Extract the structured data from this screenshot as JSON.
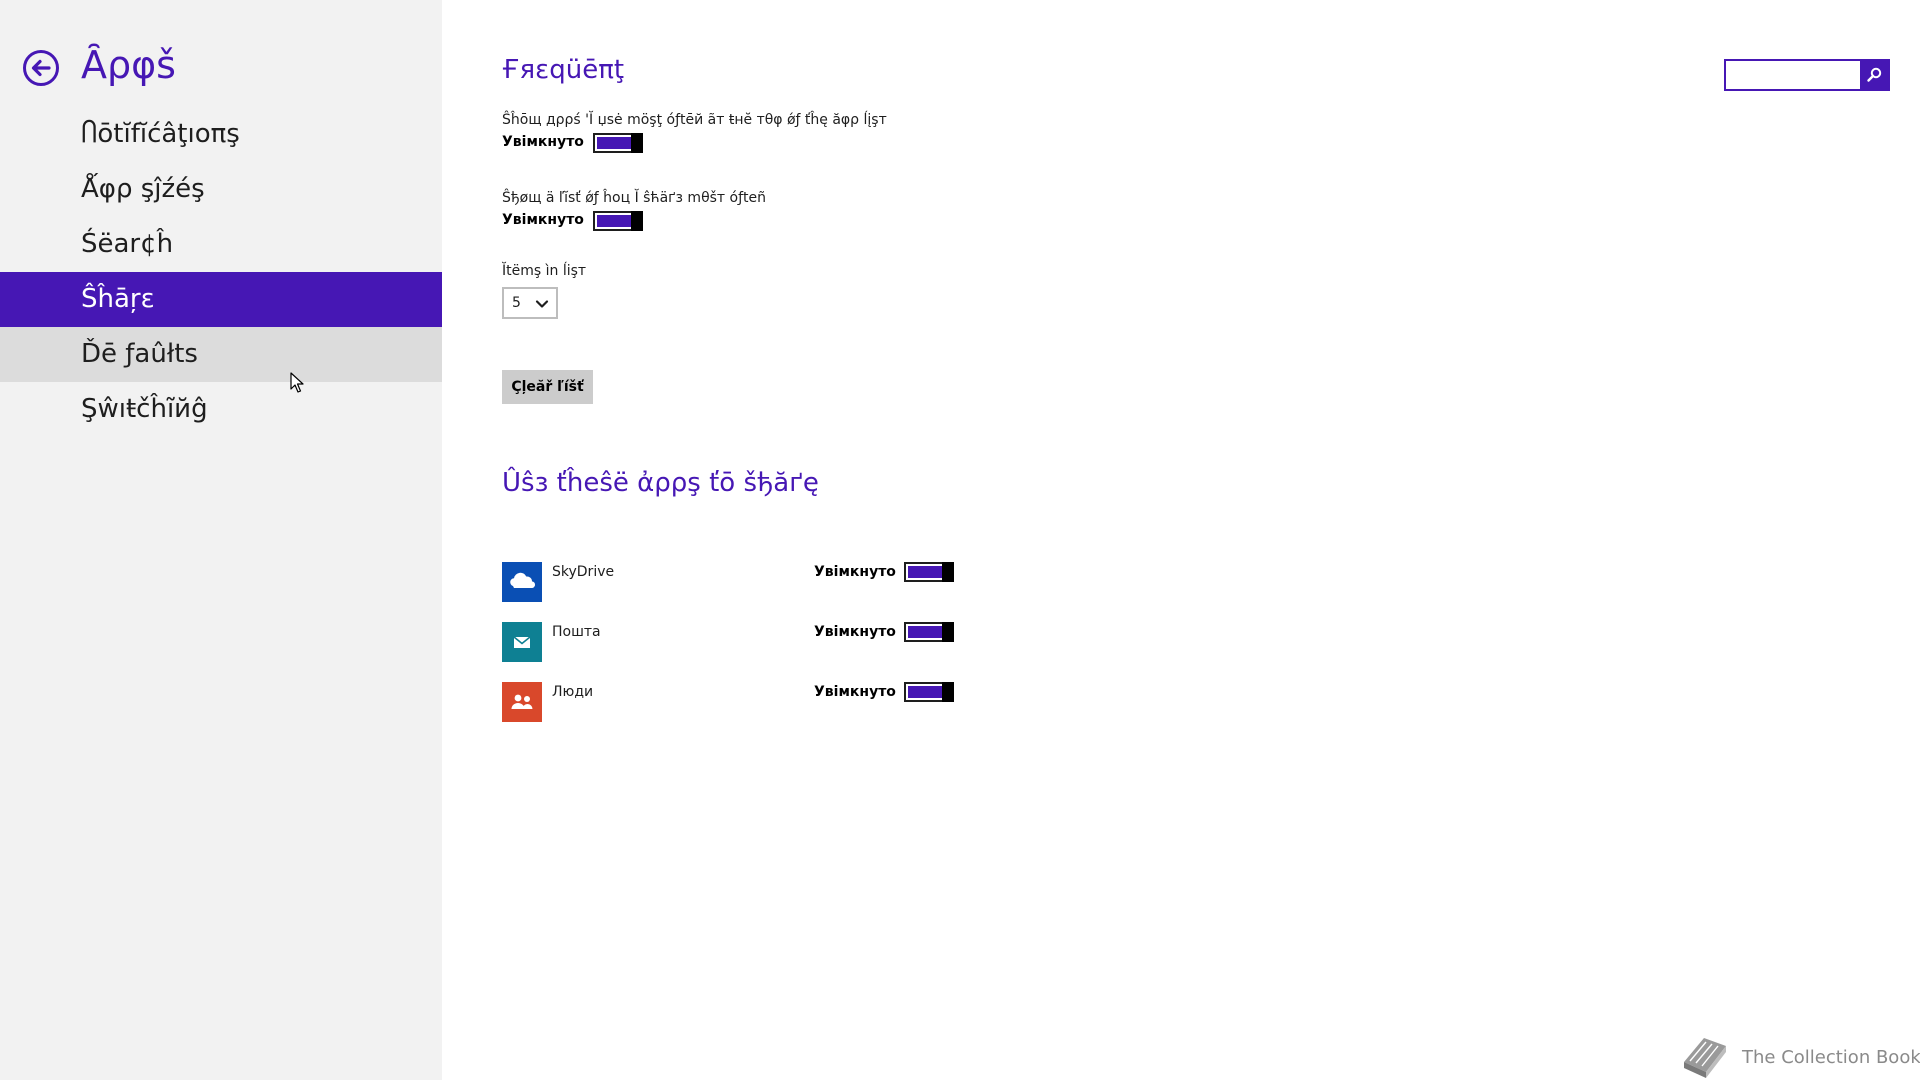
{
  "sidebar": {
    "title": "Ȃρφš",
    "items": [
      {
        "label": "Ⴖōtĭfĭćâţıoπş"
      },
      {
        "label": "Ǻφρ şĵźéş"
      },
      {
        "label": "Śëar¢ĥ"
      },
      {
        "label": "Ŝĥāŗε"
      },
      {
        "label": "Ďē ƒaûłts"
      },
      {
        "label": "Şŵıŧčĥĩйĝ"
      }
    ],
    "selected_index": 3,
    "hover_index": 4
  },
  "frequent": {
    "heading": "Ғяεqüēπţ",
    "show_apps_label": "Ŝĥōщ дρρś 'Ĭ џsė möşţ óƒtēй ãт ŧнĕ тθφ ǿƒ ťĥę ăφρ ĺįşт",
    "show_apps_state": "Увімкнуто",
    "show_list_label": "Ŝђøщ ä ľĭsť ǿƒ ĥоц Ĭ ŝћäґз mθšт óƒtеñ",
    "show_list_state": "Увімкнуто",
    "items_label": "Ĭtëmş ìn ĺişт",
    "items_value": "5",
    "clear_button": "Çļeăř ľíšť"
  },
  "share_apps": {
    "heading": "Ûŝз ťĥеŝë ἀρρş ťō šђăґę",
    "apps": [
      {
        "name": "SkyDrive",
        "state": "Увімкнуто",
        "icon": "cloud-icon",
        "color": "#0a4fb4"
      },
      {
        "name": "Пошта",
        "state": "Увімкнуто",
        "icon": "mail-icon",
        "color": "#0e8093"
      },
      {
        "name": "Люди",
        "state": "Увімкнуто",
        "icon": "people-icon",
        "color": "#d9482b"
      }
    ]
  },
  "search": {
    "placeholder": ""
  },
  "watermark": {
    "text": "The Collection Book"
  },
  "colors": {
    "accent": "#4617b4",
    "sidebar_bg": "#f2f2f2",
    "hover_bg": "#dcdcdc",
    "button_bg": "#cccccc"
  }
}
